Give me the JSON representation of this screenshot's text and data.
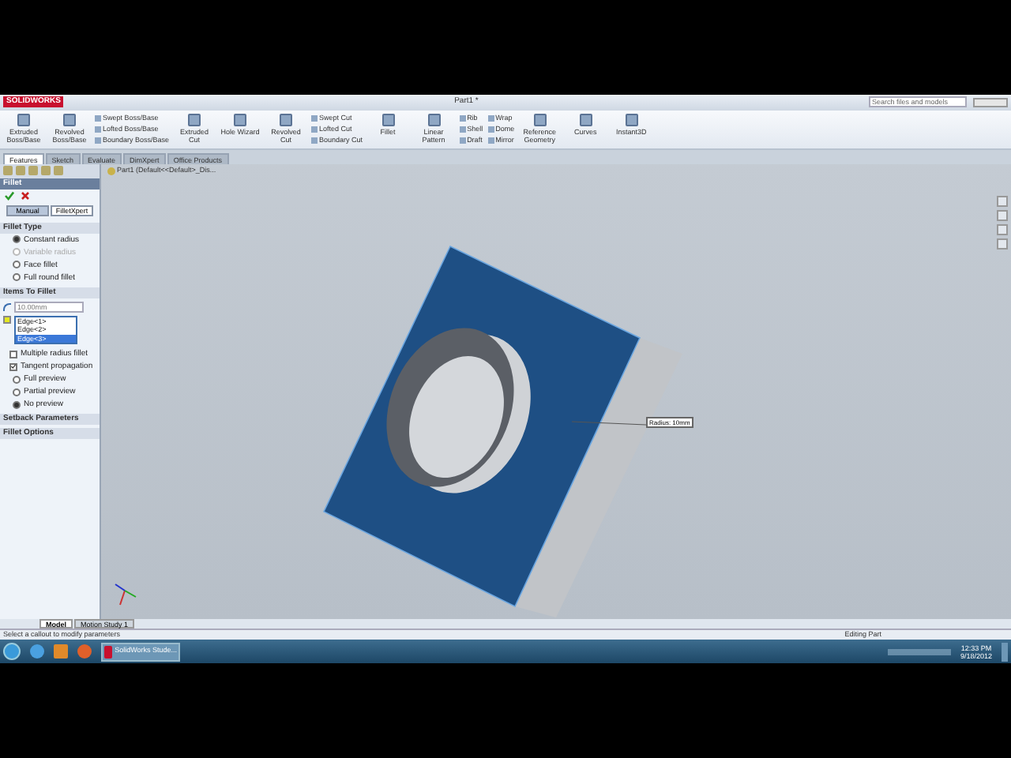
{
  "title_bar": {
    "app_logo": "SOLIDWORKS",
    "document": "Part1 *",
    "search_placeholder": "Search files and models"
  },
  "ribbon": [
    {
      "kind": "large",
      "label": "Extruded Boss/Base"
    },
    {
      "kind": "large",
      "label": "Revolved Boss/Base"
    },
    {
      "kind": "stack",
      "items": [
        "Swept Boss/Base",
        "Lofted Boss/Base",
        "Boundary Boss/Base"
      ]
    },
    {
      "kind": "large",
      "label": "Extruded Cut"
    },
    {
      "kind": "large",
      "label": "Hole Wizard"
    },
    {
      "kind": "large",
      "label": "Revolved Cut"
    },
    {
      "kind": "stack",
      "items": [
        "Swept Cut",
        "Lofted Cut",
        "Boundary Cut"
      ]
    },
    {
      "kind": "large",
      "label": "Fillet"
    },
    {
      "kind": "large",
      "label": "Linear Pattern"
    },
    {
      "kind": "stack",
      "items": [
        "Rib",
        "Shell",
        "Draft"
      ]
    },
    {
      "kind": "stack",
      "items": [
        "Wrap",
        "Dome",
        "Mirror"
      ]
    },
    {
      "kind": "large",
      "label": "Reference Geometry"
    },
    {
      "kind": "large",
      "label": "Curves"
    },
    {
      "kind": "large",
      "label": "Instant3D"
    }
  ],
  "command_tabs": [
    {
      "label": "Features",
      "selected": true
    },
    {
      "label": "Sketch",
      "selected": false
    },
    {
      "label": "Evaluate",
      "selected": false
    },
    {
      "label": "DimXpert",
      "selected": false
    },
    {
      "label": "Office Products",
      "selected": false
    }
  ],
  "feature_tree": {
    "root": "Part1 (Default<<Default>_Dis..."
  },
  "fillet_panel": {
    "title": "Fillet",
    "modes": [
      {
        "label": "Manual",
        "selected": true
      },
      {
        "label": "FilletXpert",
        "selected": false
      }
    ],
    "fillet_type": {
      "title": "Fillet Type",
      "options": [
        {
          "label": "Constant radius",
          "selected": true,
          "disabled": false
        },
        {
          "label": "Variable radius",
          "selected": false,
          "disabled": true
        },
        {
          "label": "Face fillet",
          "selected": false,
          "disabled": false
        },
        {
          "label": "Full round fillet",
          "selected": false,
          "disabled": false
        }
      ]
    },
    "items_to_fillet": {
      "title": "Items To Fillet",
      "radius": "10.00mm",
      "edges": [
        {
          "label": "Edge<1>",
          "selected": false
        },
        {
          "label": "Edge<2>",
          "selected": false
        },
        {
          "label": "Edge<3>",
          "selected": true
        }
      ],
      "checkboxes": [
        {
          "label": "Multiple radius fillet",
          "checked": false
        },
        {
          "label": "Tangent propagation",
          "checked": true
        }
      ],
      "previews": [
        {
          "label": "Full preview",
          "selected": false
        },
        {
          "label": "Partial preview",
          "selected": false
        },
        {
          "label": "No preview",
          "selected": true
        }
      ]
    },
    "collapsed_sections": [
      "Setback Parameters",
      "Fillet Options"
    ]
  },
  "viewport": {
    "callout": "Radius: 10mm"
  },
  "bottom_tabs": [
    {
      "label": "Model",
      "selected": true
    },
    {
      "label": "Motion Study 1",
      "selected": false
    }
  ],
  "status_bar": {
    "message": "Select a callout to modify parameters",
    "mode": "Editing Part"
  },
  "taskbar": {
    "window_title": "SolidWorks Stude...",
    "time": "12:33 PM",
    "date": "9/18/2012"
  }
}
